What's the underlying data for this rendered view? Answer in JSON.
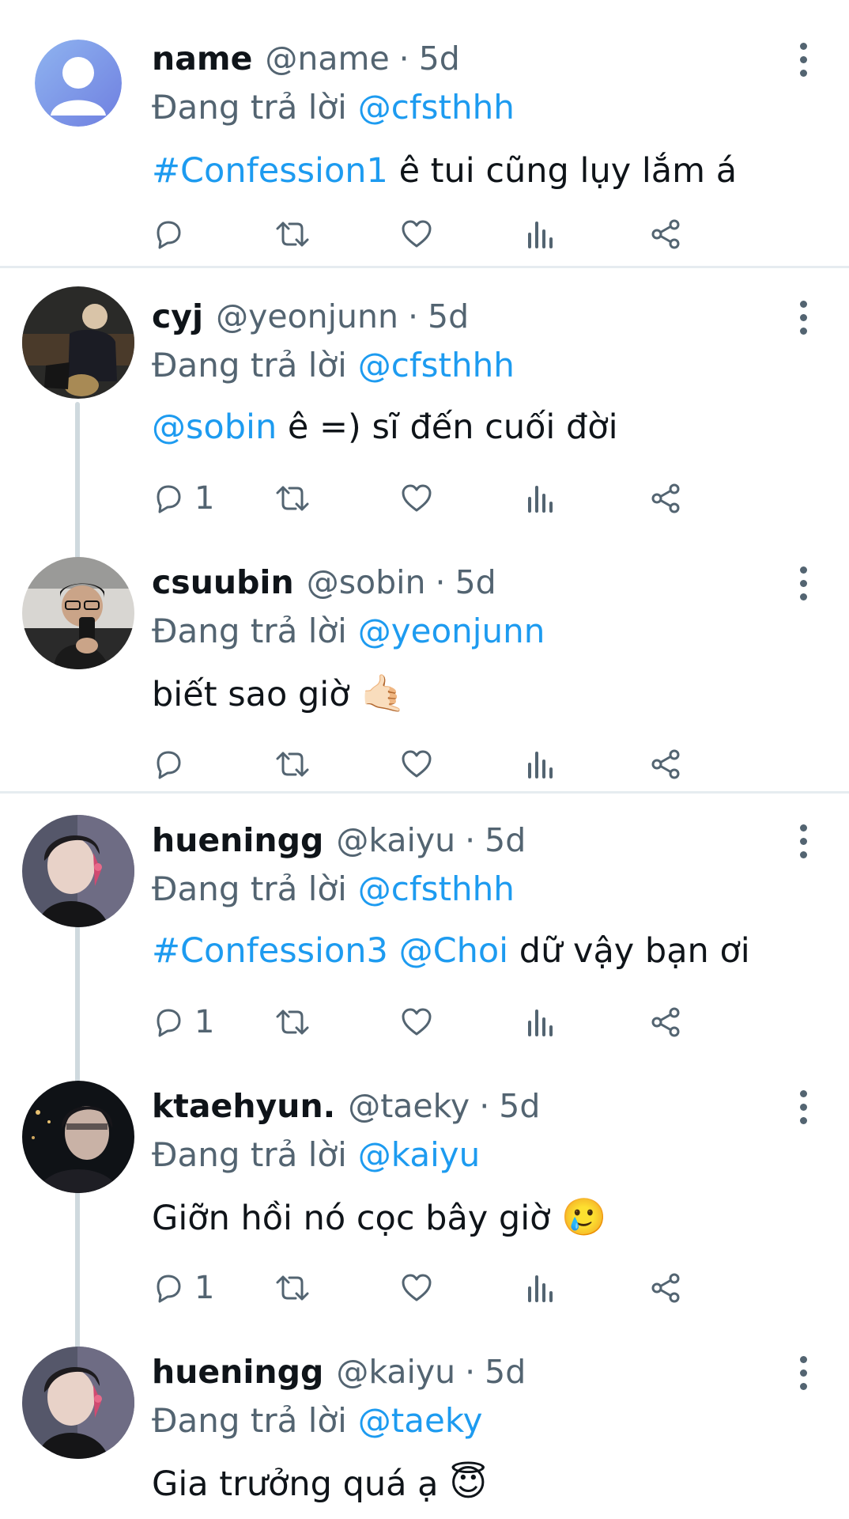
{
  "tweets": [
    {
      "display_name": "name",
      "handle": "@name",
      "time": "5d",
      "replying_prefix": "Đang trả lời",
      "replying_to": "@cfsthhh",
      "body_link": "#Confession1",
      "body_link2": "",
      "body_text": "ê tui cũng lụy lắm á",
      "reply_count": ""
    },
    {
      "display_name": "cyj",
      "handle": "@yeonjunn",
      "time": "5d",
      "replying_prefix": "Đang trả lời",
      "replying_to": "@cfsthhh",
      "body_link": "@sobin",
      "body_link2": "",
      "body_text": "ê =) sĩ đến cuối đời",
      "reply_count": "1"
    },
    {
      "display_name": "csuubin",
      "handle": "@sobin",
      "time": "5d",
      "replying_prefix": "Đang trả lời",
      "replying_to": "@yeonjunn",
      "body_link": "",
      "body_link2": "",
      "body_text": "biết sao giờ",
      "body_emoji": "🤙🏻",
      "reply_count": ""
    },
    {
      "display_name": "hueningg",
      "handle": "@kaiyu",
      "time": "5d",
      "replying_prefix": "Đang trả lời",
      "replying_to": "@cfsthhh",
      "body_link": "#Confession3",
      "body_link2": "@Choi",
      "body_text": "dữ vậy bạn ơi",
      "reply_count": "1"
    },
    {
      "display_name": "ktaehyun.",
      "handle": "@taeky",
      "time": "5d",
      "replying_prefix": "Đang trả lời",
      "replying_to": "@kaiyu",
      "body_link": "",
      "body_link2": "",
      "body_text": "Giỡn hồi nó cọc bây giờ",
      "body_emoji": "🥲",
      "reply_count": "1"
    },
    {
      "display_name": "hueningg",
      "handle": "@kaiyu",
      "time": "5d",
      "replying_prefix": "Đang trả lời",
      "replying_to": "@taeky",
      "body_link": "",
      "body_link2": "",
      "body_text": "Gia trưởng quá ạ",
      "body_emoji": "😇",
      "reply_count": ""
    }
  ],
  "icons": {
    "reply": "reply-icon",
    "retweet": "retweet-icon",
    "like": "heart-icon",
    "views": "views-icon",
    "share": "share-icon",
    "more": "more-icon"
  },
  "colors": {
    "link": "#1d9bf0",
    "secondary_text": "#536471",
    "thread_line": "#cfd9de",
    "divider": "#e6ecf0"
  }
}
